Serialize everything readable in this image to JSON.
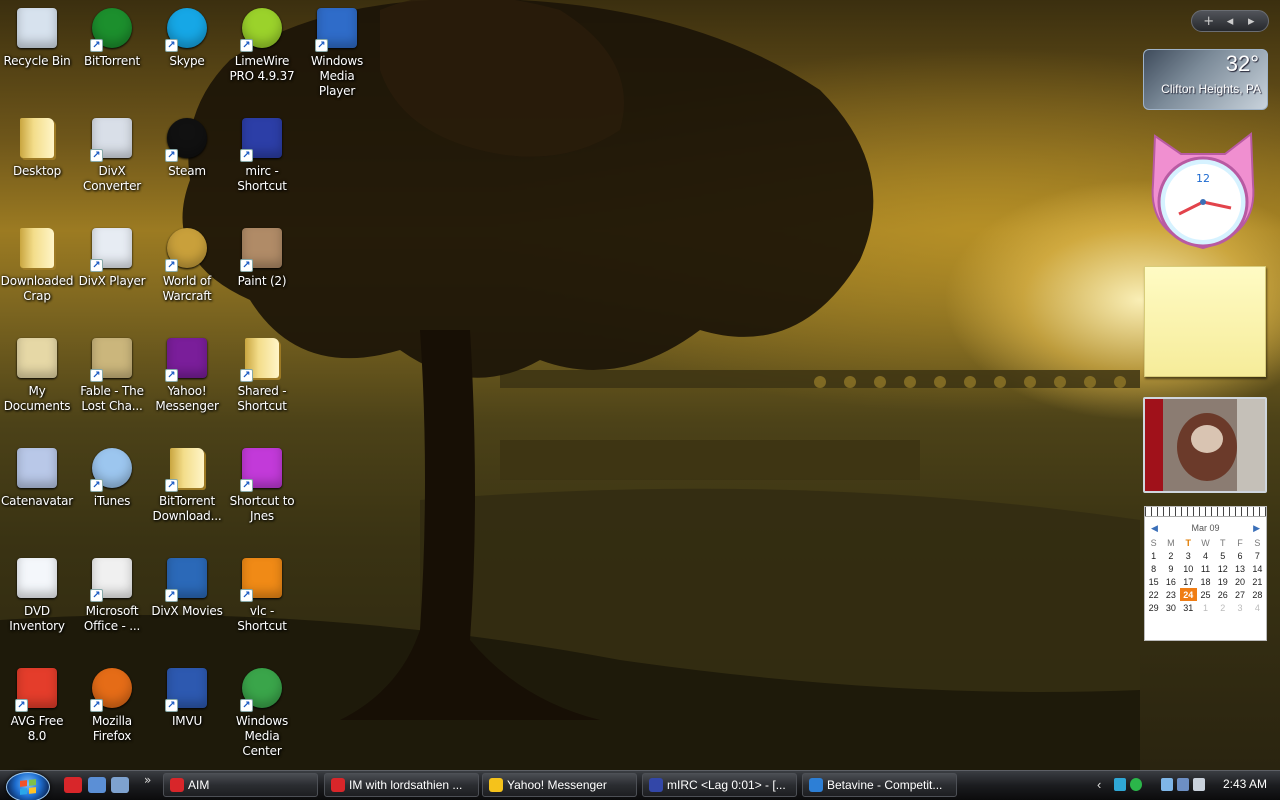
{
  "desktop": {
    "icons": [
      {
        "label": "Recycle Bin",
        "icon": "recycle-bin-icon"
      },
      {
        "label": "BitTorrent",
        "icon": "bittorrent-icon"
      },
      {
        "label": "Skype",
        "icon": "skype-icon"
      },
      {
        "label": "LimeWire PRO 4.9.37",
        "icon": "limewire-icon"
      },
      {
        "label": "Windows Media Player",
        "icon": "media-player-icon"
      },
      {
        "label": "Desktop",
        "icon": "folder-icon"
      },
      {
        "label": "DivX Converter",
        "icon": "divx-converter-icon"
      },
      {
        "label": "Steam",
        "icon": "steam-icon"
      },
      {
        "label": "mirc - Shortcut",
        "icon": "mirc-icon"
      },
      {
        "label": "Downloaded Crap",
        "icon": "folder-icon"
      },
      {
        "label": "DivX Player",
        "icon": "divx-player-icon"
      },
      {
        "label": "World of Warcraft",
        "icon": "warcraft-icon"
      },
      {
        "label": "Paint (2)",
        "icon": "paint-icon"
      },
      {
        "label": "My Documents",
        "icon": "documents-icon"
      },
      {
        "label": "Fable - The Lost Cha...",
        "icon": "fable-icon"
      },
      {
        "label": "Yahoo! Messenger",
        "icon": "yahoo-messenger-icon"
      },
      {
        "label": "Shared - Shortcut",
        "icon": "folder-icon"
      },
      {
        "label": "Catenavatar",
        "icon": "image-file-icon"
      },
      {
        "label": "iTunes",
        "icon": "itunes-icon"
      },
      {
        "label": "BitTorrent Download...",
        "icon": "folder-icon"
      },
      {
        "label": "Shortcut to Jnes",
        "icon": "jnes-icon"
      },
      {
        "label": "DVD Inventory",
        "icon": "word-document-icon"
      },
      {
        "label": "Microsoft Office - ...",
        "icon": "office-icon"
      },
      {
        "label": "DivX Movies",
        "icon": "divx-movies-icon"
      },
      {
        "label": "vlc - Shortcut",
        "icon": "vlc-icon"
      },
      {
        "label": "AVG Free 8.0",
        "icon": "avg-icon"
      },
      {
        "label": "Mozilla Firefox",
        "icon": "firefox-icon"
      },
      {
        "label": "IMVU",
        "icon": "imvu-icon"
      },
      {
        "label": "Windows Media Center",
        "icon": "media-center-icon"
      }
    ]
  },
  "gadgets": {
    "weather": {
      "temperature": "32°",
      "location": "Clifton Heights, PA"
    },
    "clock": {
      "label": "12"
    },
    "calendar": {
      "month": "Mar 09",
      "days_of_week": [
        "S",
        "M",
        "T",
        "W",
        "T",
        "F",
        "S"
      ],
      "today": "24",
      "weeks": [
        [
          "1",
          "2",
          "3",
          "4",
          "5",
          "6",
          "7"
        ],
        [
          "8",
          "9",
          "10",
          "11",
          "12",
          "13",
          "14"
        ],
        [
          "15",
          "16",
          "17",
          "18",
          "19",
          "20",
          "21"
        ],
        [
          "22",
          "23",
          "24",
          "25",
          "26",
          "27",
          "28"
        ],
        [
          "29",
          "30",
          "31",
          "1",
          "2",
          "3",
          "4"
        ]
      ]
    },
    "sidebar_controls": {
      "add": "+",
      "prev": "◂",
      "next": "▸"
    }
  },
  "taskbar": {
    "tasks": [
      {
        "label": "AIM",
        "color": "#d8262a"
      },
      {
        "label": "IM with lordsathien ...",
        "color": "#d8262a"
      },
      {
        "label": "Yahoo! Messenger",
        "color": "#f5c21b"
      },
      {
        "label": "mIRC <Lag 0:01> - [...",
        "color": "#3347a8"
      },
      {
        "label": "Betavine - Competit...",
        "color": "#2d7fd6"
      }
    ],
    "overflow_chevron": "»",
    "tray": {
      "show_hidden": "‹",
      "time": "2:43 AM"
    }
  }
}
